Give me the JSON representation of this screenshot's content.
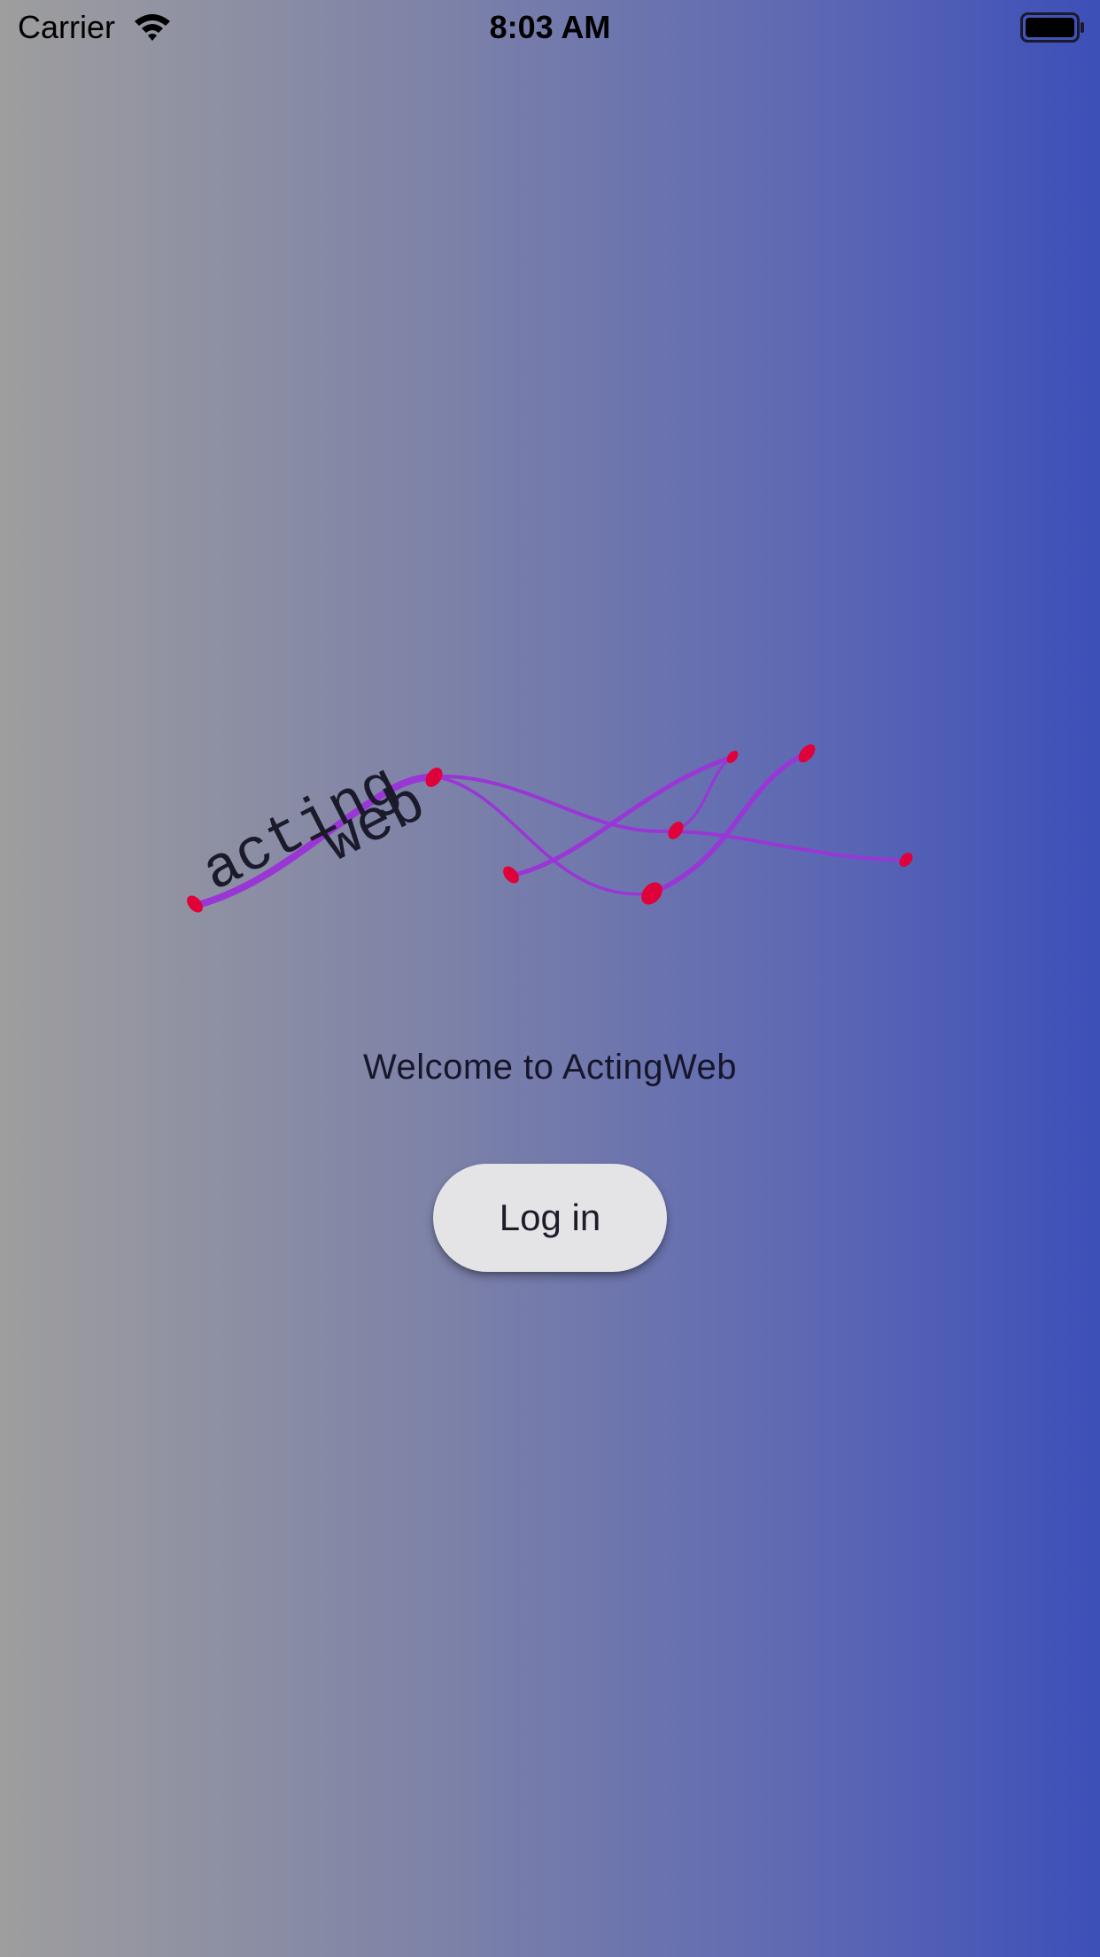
{
  "status_bar": {
    "carrier": "Carrier",
    "time": "8:03 AM",
    "wifi_icon": "wifi-icon",
    "battery_icon": "battery-full-icon"
  },
  "logo": {
    "word_top": "acting",
    "word_bottom": "web",
    "line_color": "#9a35d6",
    "node_color": "#e0003a"
  },
  "welcome": {
    "text": "Welcome to ActingWeb"
  },
  "login": {
    "label": "Log in"
  },
  "colors": {
    "gradient_start": "#9e9e9e",
    "gradient_end": "#3d4fb8",
    "button_bg": "#e4e4e6"
  }
}
